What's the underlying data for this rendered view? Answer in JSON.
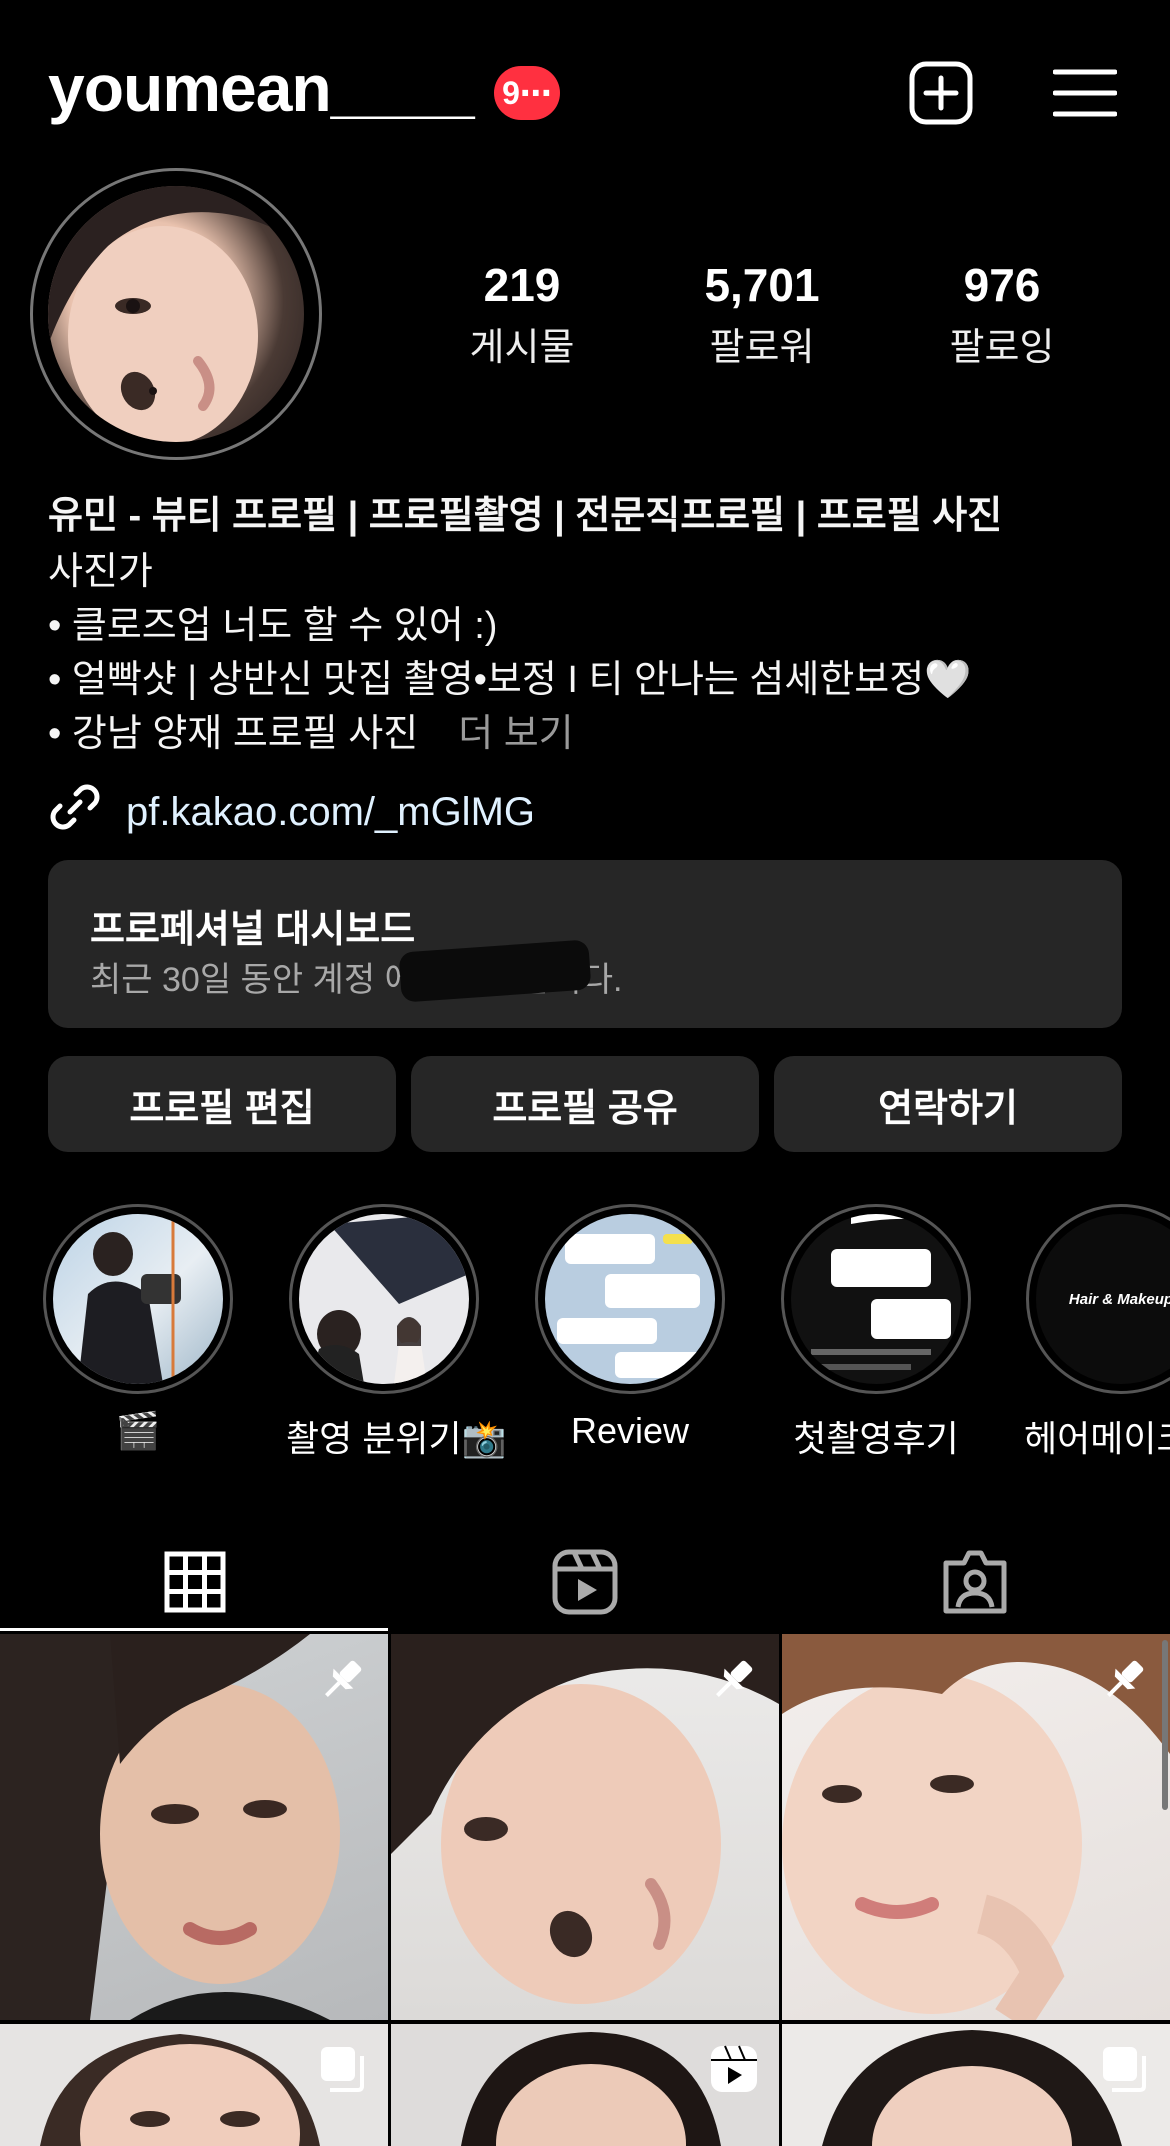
{
  "header": {
    "username": "youmean____",
    "notification_badge": "9⋯",
    "add_icon": "plus-square-icon",
    "menu_icon": "hamburger-menu-icon"
  },
  "stats": [
    {
      "value": "219",
      "label": "게시물"
    },
    {
      "value": "5,701",
      "label": "팔로워"
    },
    {
      "value": "976",
      "label": "팔로잉"
    }
  ],
  "bio": {
    "name_line": "유민 - 뷰티 프로필 | 프로필촬영 | 전문직프로필 | 프로필 사진",
    "category": "사진가",
    "lines": [
      "• 클로즈업 너도 할 수 있어 :)",
      "• 얼빡샷 | 상반신 맛집 촬영•보정 I 티 안나는 섬세한보정🤍",
      "• 강남 양재 프로필 사진"
    ],
    "more": "더 보기",
    "link": "pf.kakao.com/_mGlMG"
  },
  "dashboard": {
    "title": "프로페셔널 대시보드",
    "subtitle": "최근 30일 동안 계정                 에 도달했습니다."
  },
  "buttons": {
    "edit": "프로필 편집",
    "share": "프로필 공유",
    "contact": "연락하기"
  },
  "highlights": [
    {
      "label": "🎬"
    },
    {
      "label": "촬영 분위기📸"
    },
    {
      "label": "Review"
    },
    {
      "label": "첫촬영후기"
    },
    {
      "label": "헤어메이크",
      "cover_text": "Hair & Makeup"
    }
  ],
  "tabs": [
    "grid-icon",
    "reels-icon",
    "tagged-icon"
  ],
  "colors": {
    "badge": "#ff3040",
    "background": "#000000",
    "surface": "#262626",
    "link": "#e0f1ff"
  }
}
